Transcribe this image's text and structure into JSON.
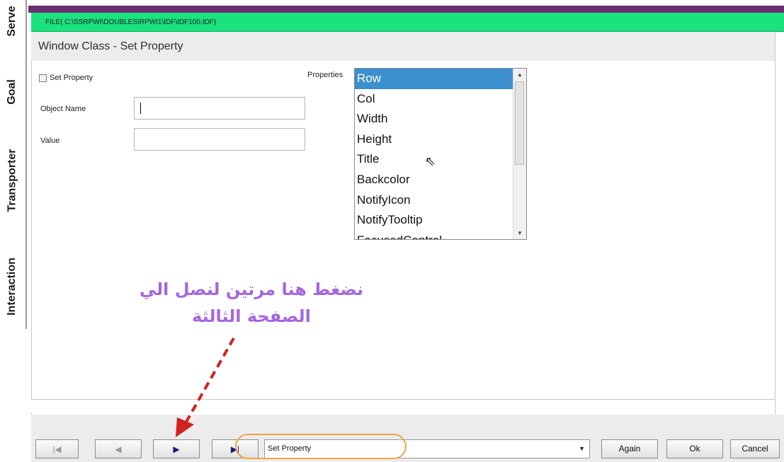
{
  "side_tabs": [
    "Serve",
    "Goal",
    "Transporter",
    "Interaction"
  ],
  "file_bar": "FILE( C:\\SSRPWI\\DOUBLES\\RPWI1\\IDF\\IDF100.IDF)",
  "title": "Window Class - Set Property",
  "form": {
    "checkbox_label": "Set Property",
    "object_name_label": "Object Name",
    "value_label": "Value",
    "properties_label": "Properties",
    "object_name_value": "",
    "value_value": ""
  },
  "properties_list": [
    "Row",
    "Col",
    "Width",
    "Height",
    "Title",
    "Backcolor",
    "NotifyIcon",
    "NotifyTooltip",
    "FocusedControl"
  ],
  "selected_property": "Row",
  "bottom": {
    "combo_value": "Set Property",
    "again": "Again",
    "ok": "Ok",
    "cancel": "Cancel"
  },
  "annotation": {
    "line1": "نضغط هنا مرتين لنصل الي",
    "line2": "الصفحة الثالثة"
  },
  "colors": {
    "file_bar": "#19e27f",
    "selection": "#3c8fce",
    "annotation": "#a566e0",
    "arrow": "#d0221f",
    "oval": "#f0a340"
  }
}
